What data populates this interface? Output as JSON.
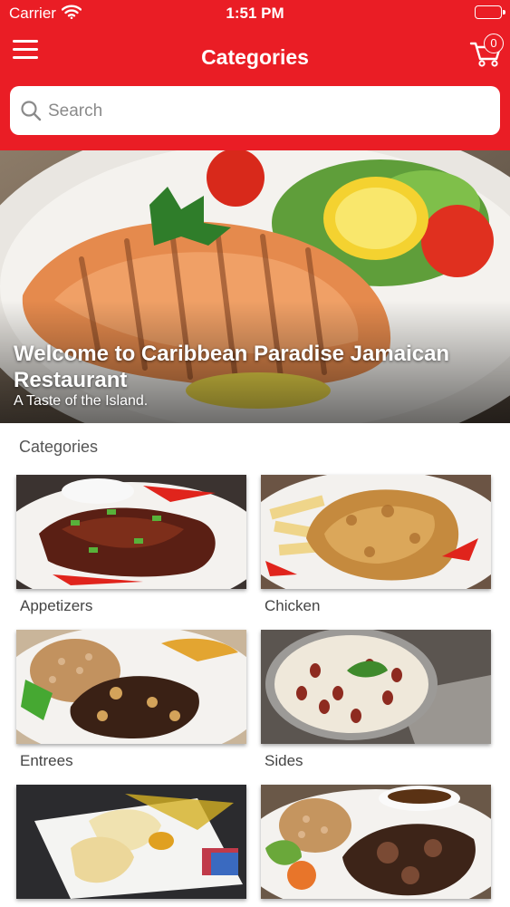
{
  "status_bar": {
    "carrier": "Carrier",
    "time": "1:51 PM",
    "wifi_icon": "wifi-icon",
    "battery_icon": "battery-icon"
  },
  "header": {
    "title": "Categories",
    "menu_icon": "hamburger-menu-icon",
    "cart_icon": "shopping-cart-icon",
    "cart_count": "0",
    "background_color": "#ea1d25"
  },
  "search": {
    "placeholder": "Search",
    "value": "",
    "icon": "search-icon"
  },
  "hero": {
    "title": "Welcome to Caribbean Paradise Jamaican Restaurant",
    "subtitle": "A Taste of the Island."
  },
  "categories": {
    "heading": "Categories",
    "items": [
      {
        "label": "Appetizers"
      },
      {
        "label": "Chicken"
      },
      {
        "label": "Entrees"
      },
      {
        "label": "Sides"
      },
      {
        "label": ""
      },
      {
        "label": ""
      }
    ]
  }
}
